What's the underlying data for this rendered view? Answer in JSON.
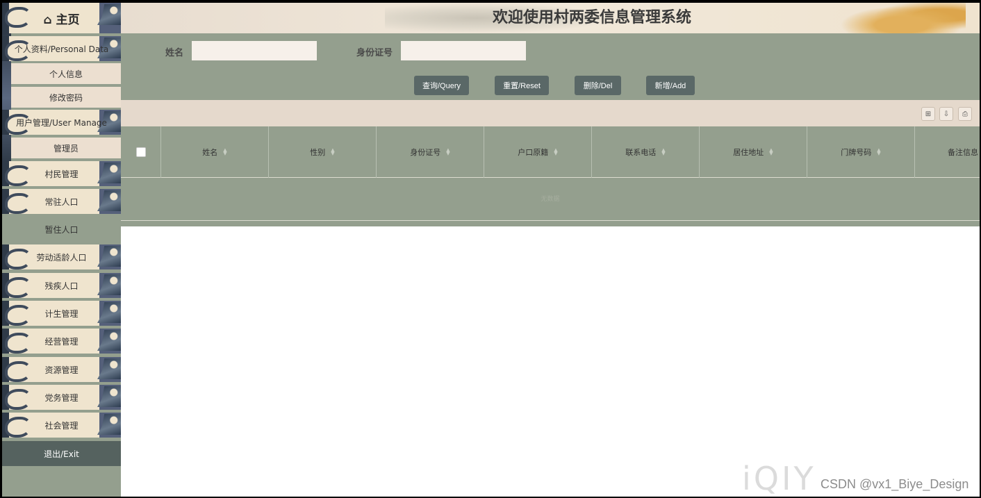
{
  "sidebar": {
    "home": "⌂ 主页",
    "personal": "个人资料/Personal Data",
    "personal_info": "个人信息",
    "change_password": "修改密码",
    "user_manage": "用户管理/User Manage",
    "admin": "管理员",
    "items": [
      "村民管理",
      "常驻人口",
      "暂住人口",
      "劳动适龄人口",
      "残疾人口",
      "计生管理",
      "经营管理",
      "资源管理",
      "党务管理",
      "社会管理"
    ],
    "active": "暂住人口",
    "exit": "退出/Exit"
  },
  "header": {
    "title": "欢迎使用村两委信息管理系统"
  },
  "search": {
    "name_label": "姓名",
    "name_value": "",
    "id_label": "身份证号",
    "id_value": "",
    "query": "查询/Query",
    "reset": "重置/Reset",
    "delete": "删除/Del",
    "add": "新增/Add"
  },
  "toolbar": {
    "columns": "⊞",
    "export": "⇩",
    "print": "⎙"
  },
  "table": {
    "columns": [
      "姓名",
      "性别",
      "身份证号",
      "户口原籍",
      "联系电话",
      "居住地址",
      "门牌号码",
      "备注信息"
    ],
    "empty_text": "无数据"
  },
  "watermark": {
    "logo": "iQIY",
    "credit": "CSDN @vx1_Biye_Design"
  }
}
